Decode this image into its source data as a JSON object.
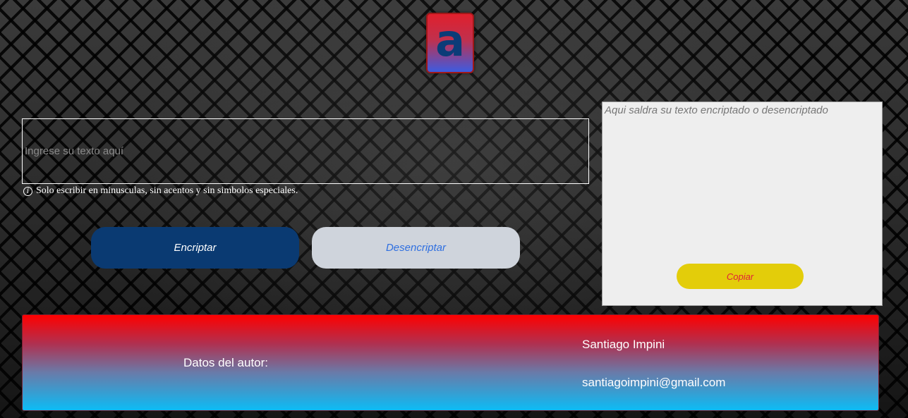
{
  "logo": {
    "letter": "a"
  },
  "input": {
    "placeholder": "Ingrese su texto aquí"
  },
  "hint": {
    "icon": "info-icon",
    "glyph": "i",
    "text": "Solo escribir en minusculas, sin acentos y sin simbolos especiales."
  },
  "buttons": {
    "encrypt": "Encriptar",
    "decrypt": "Desencriptar"
  },
  "output": {
    "placeholder": "Aqui saldra su texto encriptado o desencriptado",
    "copy": "Copiar"
  },
  "footer": {
    "label": "Datos del autor:",
    "name": "Santiago Impini",
    "email": "santiagoimpini@gmail.com"
  },
  "colors": {
    "encrypt_bg": "#0a3a72",
    "decrypt_bg": "#cfd4dc",
    "decrypt_text": "#2f6fe0",
    "copy_bg": "#e3cd0a",
    "copy_text": "#e0203a",
    "footer_top": "#ff0000",
    "footer_bottom": "#0cbcf5"
  }
}
